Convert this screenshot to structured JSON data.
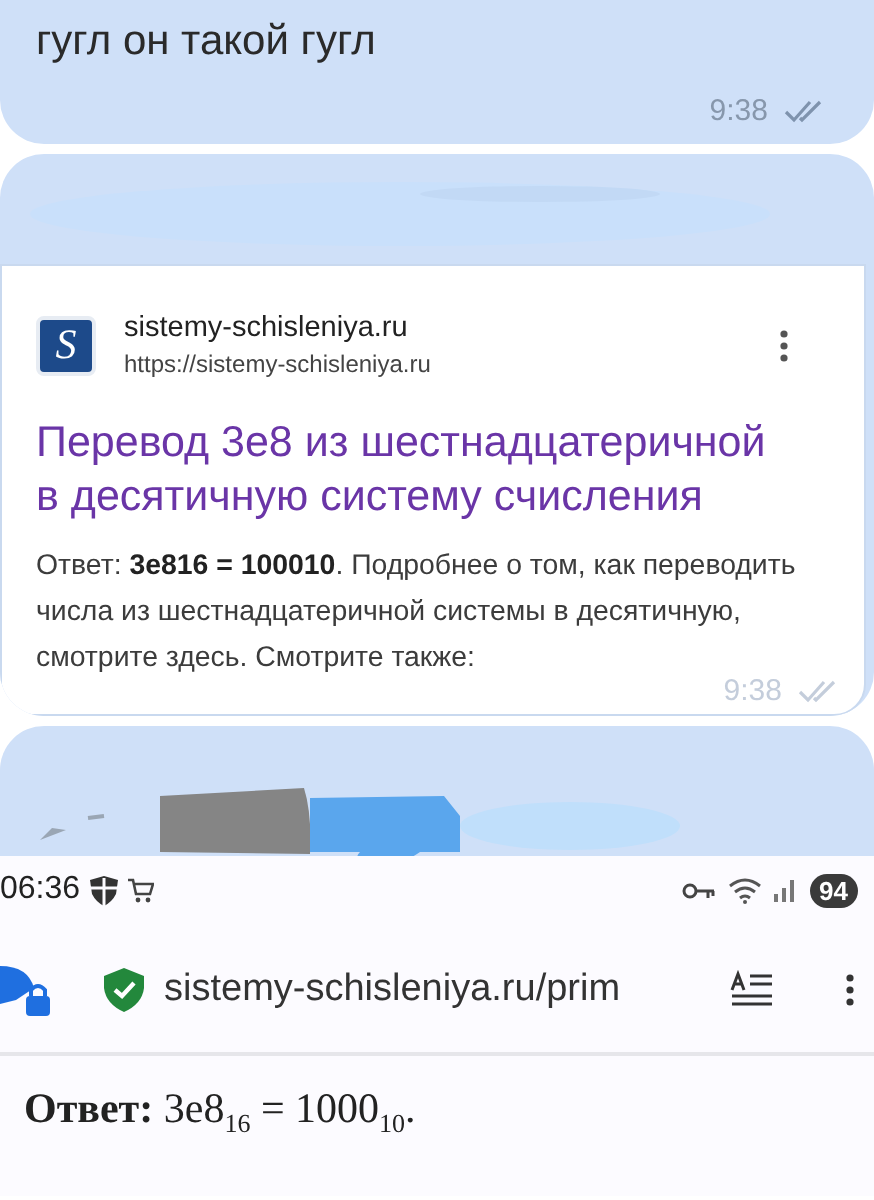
{
  "messages": [
    {
      "kind": "text",
      "text": "гугл он такой гугл",
      "time": "9:38",
      "read": true
    },
    {
      "kind": "search_result",
      "favicon_letter": "S",
      "site_name": "sistemy-schisleniya.ru",
      "url": "https://sistemy-schisleniya.ru",
      "title": "Перевод 3e8 из шестнадцатеричной в десятичную систему счисления",
      "snippet": "Ответ: **3e816 = 100010**. Подробнее о том, как переводить числа из шестнадцатеричной системы в десятичную, смотрите здесь. Смотрите также:",
      "time": "9:38",
      "read": true
    },
    {
      "kind": "browser",
      "status_time": "06:36",
      "battery": "94",
      "address": "sistemy-schisleniya.ru/prim",
      "answer": "**Ответ:** 3e8$_{16}$ = 1000$_{10}$."
    }
  ]
}
